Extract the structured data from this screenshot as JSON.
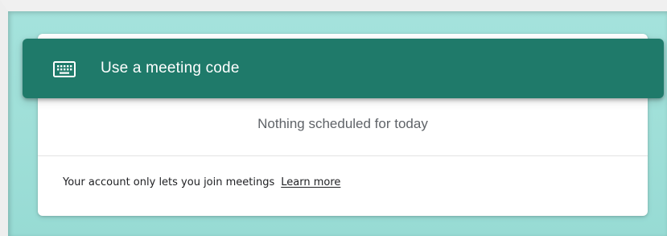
{
  "meeting_code": {
    "label": "Use a meeting code",
    "icon": "keyboard-icon",
    "color": "#1f7a6a"
  },
  "schedule": {
    "empty_message": "Nothing scheduled for today"
  },
  "account_notice": {
    "message": "Your account only lets you join meetings",
    "link_label": "Learn more"
  },
  "colors": {
    "background": "#a4e2dc",
    "card": "#ffffff"
  }
}
